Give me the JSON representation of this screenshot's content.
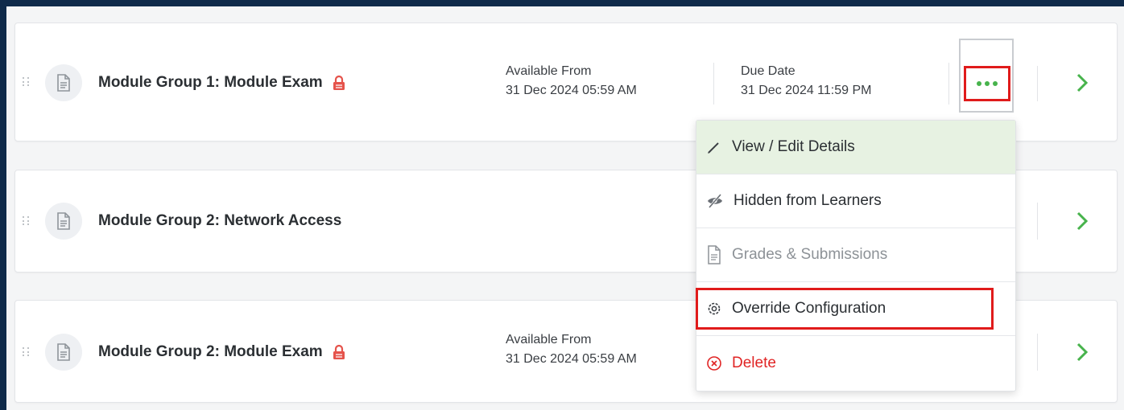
{
  "rows": [
    {
      "title": "Module Group 1: Module Exam",
      "available_label": "Available From",
      "available_value": "31 Dec 2024 05:59 AM",
      "due_label": "Due Date",
      "due_value": "31 Dec 2024 11:59 PM",
      "icon": "document-icon",
      "locked": true
    },
    {
      "title": "Module Group 2: Network Access",
      "icon": "document-icon",
      "locked": false
    },
    {
      "title": "Module Group 2: Module Exam",
      "available_label": "Available From",
      "available_value": "31 Dec 2024 05:59 AM",
      "icon": "document-icon",
      "locked": true
    }
  ],
  "menu": {
    "items": [
      {
        "label": "View / Edit Details",
        "icon": "pencil-icon"
      },
      {
        "label": "Hidden from Learners",
        "icon": "eye-slash-icon"
      },
      {
        "label": "Grades & Submissions",
        "icon": "document-icon"
      },
      {
        "label": "Override Configuration",
        "icon": "gear-icon"
      },
      {
        "label": "Delete",
        "icon": "circle-x-icon"
      }
    ]
  },
  "colors": {
    "accent_green": "#47b34c",
    "lock_red": "#e5534b",
    "highlight_red": "#e01b1b",
    "delete_red": "#e02424",
    "menu_highlight": "#e7f2e2"
  }
}
